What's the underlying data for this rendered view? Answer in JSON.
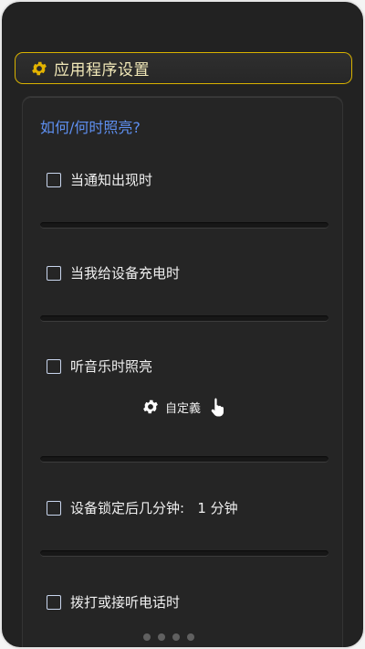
{
  "header": {
    "icon": "gear-icon",
    "title": "应用程序设置",
    "border_color": "#d8b200"
  },
  "section": {
    "question": "如何/何时照亮?",
    "question_color": "#5e8ff0"
  },
  "options": [
    {
      "label": "当通知出现时",
      "checked": false
    },
    {
      "label": "当我给设备充电时",
      "checked": false
    },
    {
      "label": "听音乐时照亮",
      "checked": false
    },
    {
      "label": "设备锁定后几分钟:   1 分钟",
      "checked": false
    },
    {
      "label": "拨打或接听电话时",
      "checked": false
    }
  ],
  "customize": {
    "label": "自定義",
    "icons": [
      "gear-icon",
      "hand-pointer-icon"
    ]
  }
}
